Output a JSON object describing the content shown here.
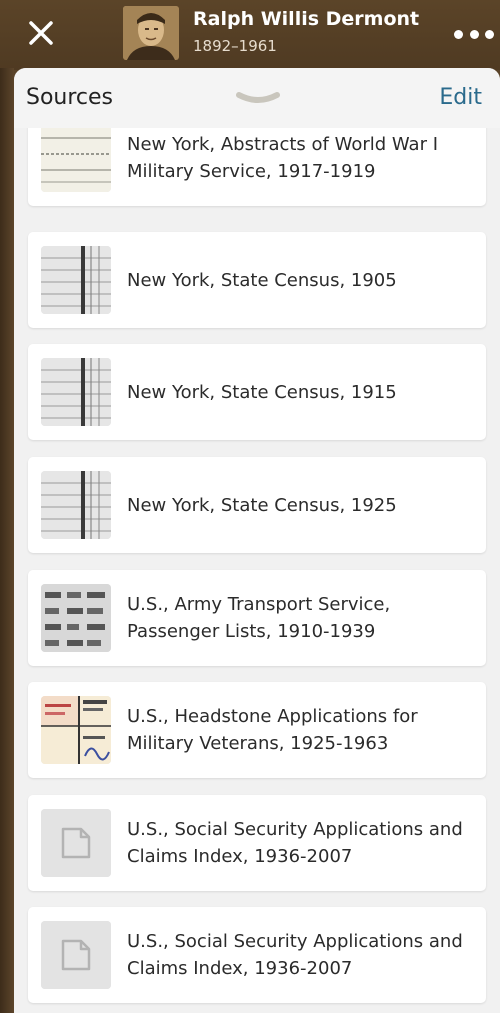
{
  "header": {
    "close_icon": "close-icon",
    "person_name": "Ralph Willis Dermont",
    "person_dates": "1892–1961",
    "more_icon": "more-horizontal-icon"
  },
  "sheet": {
    "title": "Sources",
    "edit_label": "Edit",
    "grabber_icon": "drag-handle-icon",
    "accent_color": "#2a6a8c"
  },
  "sources": [
    {
      "title": "New York, Abstracts of World War I Military Service, 1917-1919",
      "thumb": "document-scan"
    },
    {
      "title": "New York, State Census, 1905",
      "thumb": "census-scan"
    },
    {
      "title": "New York, State Census, 1915",
      "thumb": "census-scan"
    },
    {
      "title": "New York, State Census, 1925",
      "thumb": "census-scan"
    },
    {
      "title": "U.S., Army Transport Service, Passenger Lists, 1910-1939",
      "thumb": "list-scan"
    },
    {
      "title": "U.S., Headstone Applications for Military Veterans, 1925-1963",
      "thumb": "form-scan"
    },
    {
      "title": "U.S., Social Security Applications and Claims Index, 1936-2007",
      "thumb": "generic-document-icon"
    },
    {
      "title": "U.S., Social Security Applications and Claims Index, 1936-2007",
      "thumb": "generic-document-icon"
    }
  ]
}
